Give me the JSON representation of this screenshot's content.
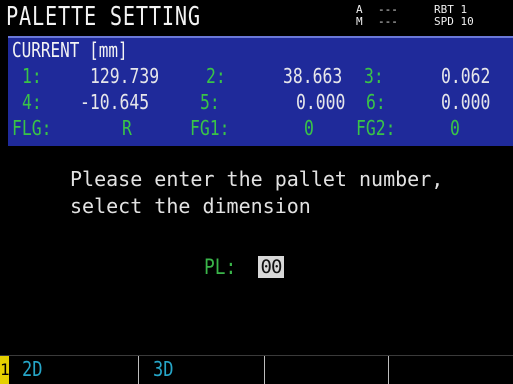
{
  "header": {
    "title": "PALETTE SETTING",
    "status_left": [
      "A",
      "M"
    ],
    "status_mid": [
      "---",
      "---"
    ],
    "status_right": [
      "RBT 1",
      "SPD 10"
    ]
  },
  "current": {
    "label": "CURRENT [mm]",
    "axes": [
      {
        "label": "1:",
        "value": "129.739"
      },
      {
        "label": "2:",
        "value": "38.663"
      },
      {
        "label": "3:",
        "value": "0.062"
      },
      {
        "label": "4:",
        "value": "-10.645"
      },
      {
        "label": "5:",
        "value": "0.000"
      },
      {
        "label": "6:",
        "value": "0.000"
      }
    ],
    "flags": [
      {
        "label": "FLG:",
        "value": "R"
      },
      {
        "label": "FG1:",
        "value": "0"
      },
      {
        "label": "FG2:",
        "value": "0"
      }
    ]
  },
  "message": {
    "line1": "Please enter the pallet number,",
    "line2": "select the dimension"
  },
  "pallet": {
    "label": "PL:",
    "value": "00"
  },
  "fkeys": [
    {
      "number": "1",
      "label": "2D"
    },
    {
      "number": "",
      "label": "3D"
    },
    {
      "number": "",
      "label": ""
    },
    {
      "number": "",
      "label": ""
    }
  ],
  "colors": {
    "panel_bg": "#1f2a9a",
    "label_green": "#39c447",
    "fkey_cyan": "#26a6c8",
    "fkey_number_yellow": "#e5d000"
  }
}
